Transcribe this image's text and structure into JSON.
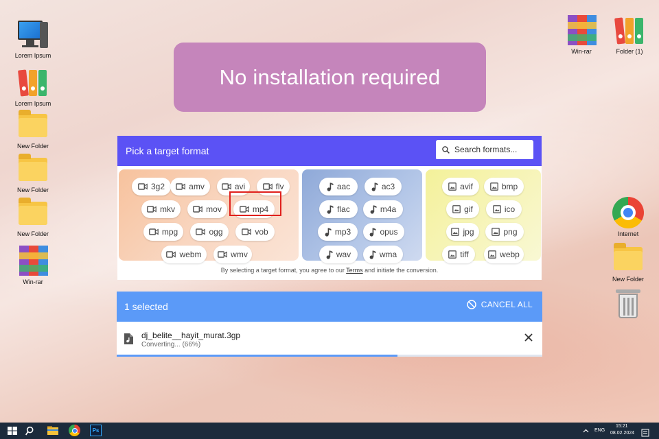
{
  "desktop": {
    "left_icons": [
      {
        "label": "Lorem Ipsum",
        "icon": "computer-icon"
      },
      {
        "label": "Lorem Ipsum",
        "icon": "binders-icon"
      },
      {
        "label": "New Folder",
        "icon": "folder-icon"
      },
      {
        "label": "New Folder",
        "icon": "folder-icon"
      },
      {
        "label": "New Folder",
        "icon": "folder-icon"
      },
      {
        "label": "Win-rar",
        "icon": "winrar-icon"
      }
    ],
    "right_icons": [
      {
        "label": "Win-rar",
        "icon": "winrar-icon"
      },
      {
        "label": "Folder (1)",
        "icon": "binders-icon"
      },
      {
        "label": "Internet",
        "icon": "chrome-icon"
      },
      {
        "label": "New Folder",
        "icon": "folder-icon"
      },
      {
        "label": "",
        "icon": "recycle-bin-icon"
      }
    ]
  },
  "banner": {
    "text": "No installation required",
    "color": "#c585bb"
  },
  "picker": {
    "title": "Pick a target format",
    "search_placeholder": "Search formats...",
    "accent": "#5b52f5",
    "video_formats": [
      "3g2",
      "amv",
      "avi",
      "flv",
      "mkv",
      "mov",
      "mp4",
      "mpg",
      "ogg",
      "vob",
      "webm",
      "wmv"
    ],
    "audio_formats": [
      "aac",
      "ac3",
      "flac",
      "m4a",
      "mp3",
      "opus",
      "wav",
      "wma"
    ],
    "image_formats": [
      "avif",
      "bmp",
      "gif",
      "ico",
      "jpg",
      "png",
      "tiff",
      "webp"
    ],
    "highlighted": "mp4",
    "terms_before": "By selecting a target format, you agree to our ",
    "terms_link": "Terms",
    "terms_after": " and initiate the conversion."
  },
  "selection": {
    "count_label": "1 selected",
    "cancel_label": "CANCEL ALL",
    "accent": "#5b9af8",
    "file": {
      "name": "dj_belite__hayit_murat.3gp",
      "status": "Converting... (66%)",
      "progress": 0.66
    }
  },
  "taskbar": {
    "apps": [
      "start-icon",
      "search-icon",
      "file-explorer-icon",
      "chrome-icon",
      "photoshop-icon"
    ],
    "photoshop_label": "Ps",
    "language": "ENG",
    "time": "15:21",
    "date": "08.02.2024"
  }
}
